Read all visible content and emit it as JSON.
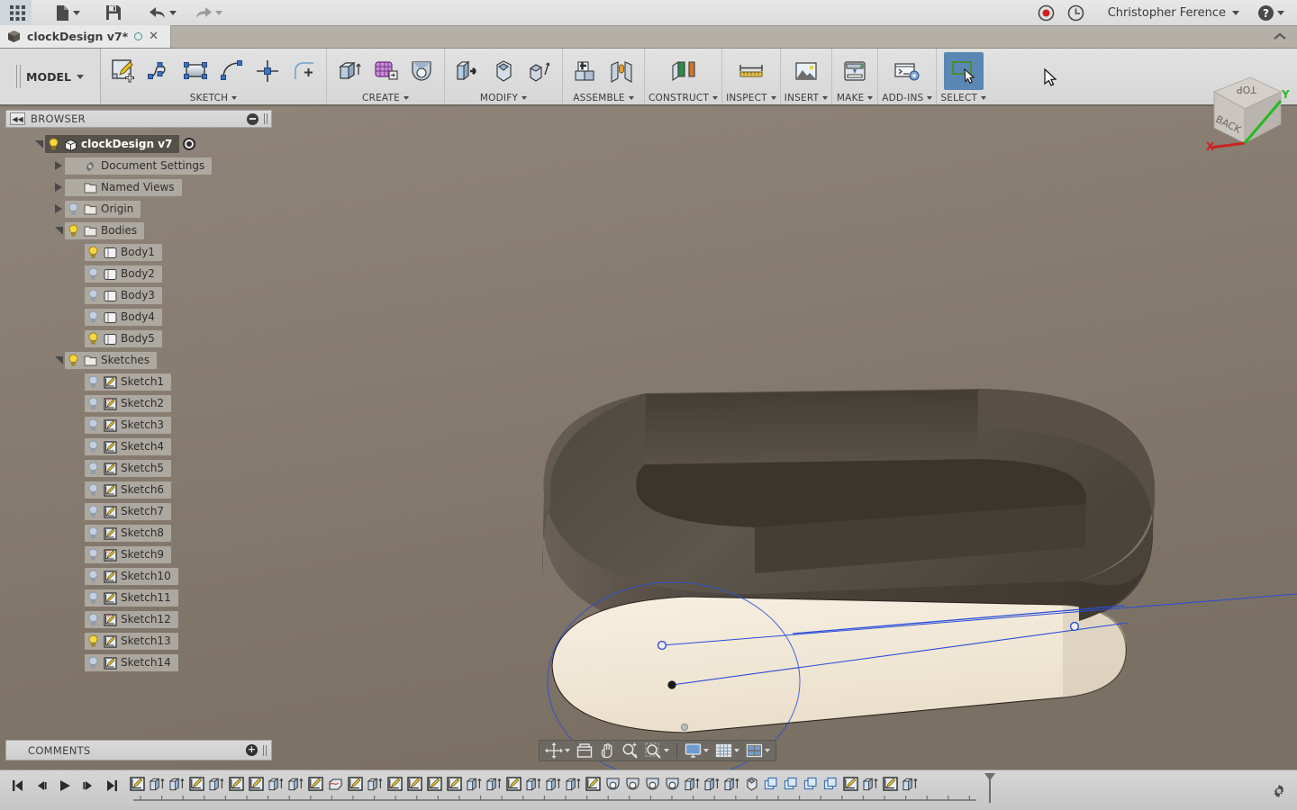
{
  "app": {
    "user_name": "Christopher Ference",
    "document_tab": "clockDesign v7*",
    "ribbon_tab": "MODEL"
  },
  "quick_access": {
    "items": [
      {
        "name": "app-grid-icon",
        "label": "Show Data Panel",
        "has_caret": false
      },
      {
        "name": "file-icon",
        "label": "File",
        "has_caret": true
      },
      {
        "name": "save-icon",
        "label": "Save",
        "has_caret": false
      },
      {
        "name": "undo-icon",
        "label": "Undo",
        "has_caret": true
      },
      {
        "name": "redo-icon",
        "label": "Redo",
        "has_caret": true
      }
    ],
    "right_items": [
      {
        "name": "record-icon",
        "label": "Screencast"
      },
      {
        "name": "job-status-icon",
        "label": "Job Status"
      }
    ],
    "help_label": "Help"
  },
  "ribbon": {
    "tab_label": "MODEL",
    "panels": [
      {
        "label": "SKETCH",
        "name": "panel-sketch",
        "icons": [
          {
            "name": "create-sketch-icon",
            "label": "Create Sketch"
          },
          {
            "name": "spline-icon",
            "label": "Spline"
          },
          {
            "name": "rectangle-icon",
            "label": "Rectangle"
          },
          {
            "name": "arc-icon",
            "label": "Arc"
          },
          {
            "name": "point-icon",
            "label": "Point"
          },
          {
            "name": "fillet-sketch-icon",
            "label": "Sketch Fillet"
          }
        ]
      },
      {
        "label": "CREATE",
        "name": "panel-create",
        "icons": [
          {
            "name": "extrude-icon",
            "label": "Extrude"
          },
          {
            "name": "mesh-icon",
            "label": "Form"
          },
          {
            "name": "revolve-icon",
            "label": "Revolve"
          }
        ]
      },
      {
        "label": "MODIFY",
        "name": "panel-modify",
        "icons": [
          {
            "name": "press-pull-icon",
            "label": "Press Pull"
          },
          {
            "name": "fillet-icon",
            "label": "Fillet"
          },
          {
            "name": "shell-icon",
            "label": "Shell"
          }
        ]
      },
      {
        "label": "ASSEMBLE",
        "name": "panel-assemble",
        "icons": [
          {
            "name": "new-component-icon",
            "label": "New Component"
          },
          {
            "name": "joint-icon",
            "label": "Joint"
          }
        ]
      },
      {
        "label": "CONSTRUCT",
        "name": "panel-construct",
        "icons": [
          {
            "name": "offset-plane-icon",
            "label": "Offset Plane"
          }
        ]
      },
      {
        "label": "INSPECT",
        "name": "panel-inspect",
        "icons": [
          {
            "name": "measure-icon",
            "label": "Measure"
          }
        ]
      },
      {
        "label": "INSERT",
        "name": "panel-insert",
        "icons": [
          {
            "name": "insert-image-icon",
            "label": "Insert Image"
          }
        ]
      },
      {
        "label": "MAKE",
        "name": "panel-make",
        "icons": [
          {
            "name": "3d-print-icon",
            "label": "3D Print"
          }
        ]
      },
      {
        "label": "ADD-INS",
        "name": "panel-addins",
        "icons": [
          {
            "name": "scripts-addins-icon",
            "label": "Scripts and Add-Ins"
          }
        ]
      },
      {
        "label": "SELECT",
        "name": "panel-select",
        "icons": [
          {
            "name": "select-icon",
            "label": "Select",
            "selected": true
          }
        ]
      }
    ]
  },
  "browser": {
    "title": "BROWSER",
    "root": {
      "label": "clockDesign v7",
      "expanded": true,
      "visible": true
    },
    "nodes": [
      {
        "label": "Document Settings",
        "icon": "gear-icon",
        "indent": 1,
        "twist": "right",
        "bulb": "none"
      },
      {
        "label": "Named Views",
        "icon": "folder-icon",
        "indent": 1,
        "twist": "right",
        "bulb": "none"
      },
      {
        "label": "Origin",
        "icon": "folder-icon",
        "indent": 1,
        "twist": "right",
        "bulb": "off"
      },
      {
        "label": "Bodies",
        "icon": "folder-icon",
        "indent": 1,
        "twist": "down",
        "bulb": "on"
      },
      {
        "label": "Body1",
        "icon": "body-icon",
        "indent": 2,
        "twist": "none",
        "bulb": "on"
      },
      {
        "label": "Body2",
        "icon": "body-icon",
        "indent": 2,
        "twist": "none",
        "bulb": "off"
      },
      {
        "label": "Body3",
        "icon": "body-icon",
        "indent": 2,
        "twist": "none",
        "bulb": "off"
      },
      {
        "label": "Body4",
        "icon": "body-icon",
        "indent": 2,
        "twist": "none",
        "bulb": "off"
      },
      {
        "label": "Body5",
        "icon": "body-icon",
        "indent": 2,
        "twist": "none",
        "bulb": "on"
      },
      {
        "label": "Sketches",
        "icon": "folder-icon",
        "indent": 1,
        "twist": "down",
        "bulb": "on"
      },
      {
        "label": "Sketch1",
        "icon": "sketch-icon",
        "indent": 2,
        "twist": "none",
        "bulb": "off"
      },
      {
        "label": "Sketch2",
        "icon": "sketch-warn-icon",
        "indent": 2,
        "twist": "none",
        "bulb": "off"
      },
      {
        "label": "Sketch3",
        "icon": "sketch-icon",
        "indent": 2,
        "twist": "none",
        "bulb": "off"
      },
      {
        "label": "Sketch4",
        "icon": "sketch-icon",
        "indent": 2,
        "twist": "none",
        "bulb": "off"
      },
      {
        "label": "Sketch5",
        "icon": "sketch-icon",
        "indent": 2,
        "twist": "none",
        "bulb": "off"
      },
      {
        "label": "Sketch6",
        "icon": "sketch-icon",
        "indent": 2,
        "twist": "none",
        "bulb": "off"
      },
      {
        "label": "Sketch7",
        "icon": "sketch-icon",
        "indent": 2,
        "twist": "none",
        "bulb": "off"
      },
      {
        "label": "Sketch8",
        "icon": "sketch-icon",
        "indent": 2,
        "twist": "none",
        "bulb": "off"
      },
      {
        "label": "Sketch9",
        "icon": "sketch-warn-icon",
        "indent": 2,
        "twist": "none",
        "bulb": "off"
      },
      {
        "label": "Sketch10",
        "icon": "sketch-icon",
        "indent": 2,
        "twist": "none",
        "bulb": "off"
      },
      {
        "label": "Sketch11",
        "icon": "sketch-icon",
        "indent": 2,
        "twist": "none",
        "bulb": "off"
      },
      {
        "label": "Sketch12",
        "icon": "sketch-warn-icon",
        "indent": 2,
        "twist": "none",
        "bulb": "off"
      },
      {
        "label": "Sketch13",
        "icon": "sketch-icon",
        "indent": 2,
        "twist": "none",
        "bulb": "on"
      },
      {
        "label": "Sketch14",
        "icon": "sketch-icon",
        "indent": 2,
        "twist": "none",
        "bulb": "off"
      }
    ]
  },
  "comments": {
    "title": "COMMENTS",
    "add_label": "+"
  },
  "navbar": {
    "items": [
      {
        "name": "orbit-icon",
        "label": "Orbit",
        "caret": true
      },
      {
        "name": "look-at-icon",
        "label": "Look At",
        "caret": false
      },
      {
        "name": "pan-icon",
        "label": "Pan",
        "caret": false
      },
      {
        "name": "zoom-icon",
        "label": "Zoom",
        "caret": false
      },
      {
        "name": "zoom-window-icon",
        "label": "Fit",
        "caret": true
      }
    ],
    "items2": [
      {
        "name": "display-settings-icon",
        "label": "Display Settings",
        "caret": true
      },
      {
        "name": "grid-snaps-icon",
        "label": "Grid and Snaps",
        "caret": true
      },
      {
        "name": "viewports-icon",
        "label": "Viewports",
        "caret": true
      }
    ]
  },
  "timeline": {
    "controls": [
      {
        "name": "go-to-beginning-button",
        "label": "Go to beginning"
      },
      {
        "name": "step-back-button",
        "label": "Step back"
      },
      {
        "name": "play-button",
        "label": "Play"
      },
      {
        "name": "step-forward-button",
        "label": "Step forward"
      },
      {
        "name": "go-to-end-button",
        "label": "Go to end"
      }
    ],
    "features": [
      "sketch",
      "extrude",
      "extrude",
      "sketch",
      "extrude",
      "sketch",
      "sketch",
      "extrude",
      "extrude",
      "sketch",
      "loft",
      "sketch",
      "extrude",
      "sketch",
      "sketch",
      "sketch",
      "sketch",
      "extrude",
      "extrude",
      "sketch",
      "extrude",
      "extrude",
      "extrude",
      "sketch",
      "revolve",
      "revolve",
      "revolve",
      "revolve",
      "extrude",
      "extrude",
      "extrude",
      "fillet",
      "pattern",
      "pattern",
      "pattern",
      "pattern",
      "sketch",
      "extrude",
      "sketch",
      "extrude"
    ],
    "settings_label": "Settings"
  },
  "viewcube": {
    "top_face": "TOP",
    "front_face": "BACK",
    "axis_x": "X",
    "axis_y": "Y",
    "axis_x_color": "#cc2222",
    "axis_y_color": "#22bb22"
  },
  "viewport": {
    "background_top": "#8e8377",
    "background_bottom": "#7d7266",
    "model_face_light": "#f2e8d8",
    "model_face_dark": "#4a443c",
    "model_face_mid": "#6a6258",
    "sketch_line_color": "#2b4cd8"
  }
}
